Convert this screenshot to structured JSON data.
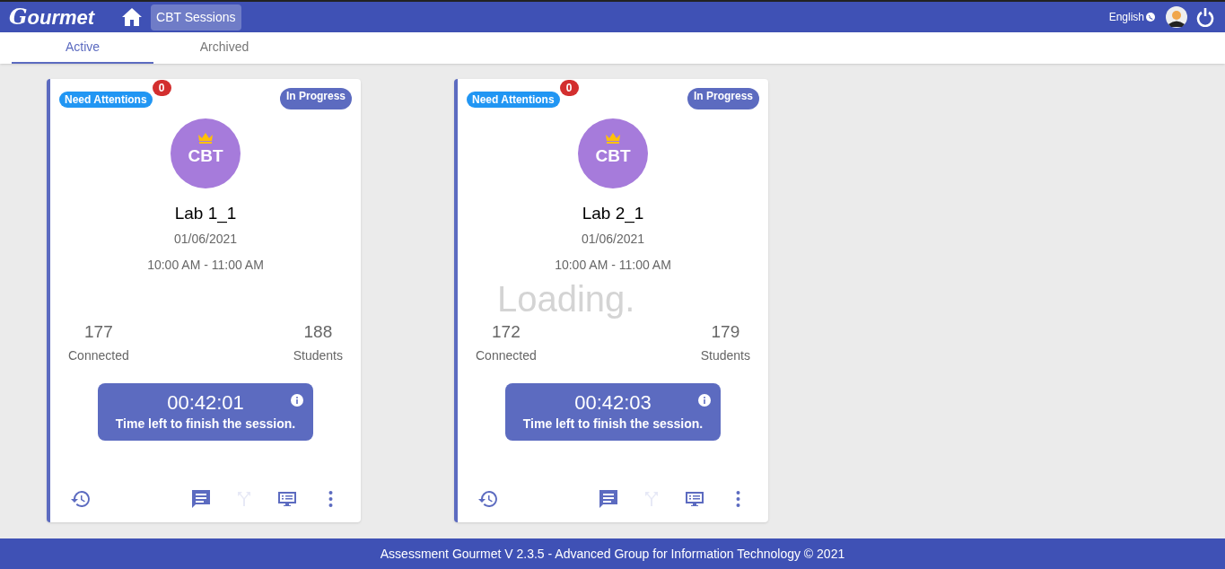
{
  "header": {
    "logo_initial": "G",
    "logo_rest": "ourmet",
    "nav": [
      {
        "label": "CBT Sessions",
        "selected": true
      }
    ],
    "language": "English"
  },
  "tabs": [
    {
      "label": "Active",
      "selected": true
    },
    {
      "label": "Archived",
      "selected": false
    }
  ],
  "sessions": [
    {
      "attention_label": "Need Attentions",
      "attention_count": "0",
      "status": "In Progress",
      "avatar_text": "CBT",
      "name": "Lab 1_1",
      "date": "01/06/2021",
      "time": "10:00 AM - 11:00 AM",
      "connected": "177",
      "connected_label": "Connected",
      "students": "188",
      "students_label": "Students",
      "timer": "00:42:01",
      "timer_label": "Time left to finish the session.",
      "actions": [
        {
          "kind": "history",
          "disabled": false
        },
        {
          "kind": "chat",
          "disabled": false
        },
        {
          "kind": "split",
          "disabled": true
        },
        {
          "kind": "screen",
          "disabled": false
        },
        {
          "kind": "more",
          "disabled": false
        }
      ]
    },
    {
      "attention_label": "Need Attentions",
      "attention_count": "0",
      "status": "In Progress",
      "avatar_text": "CBT",
      "name": "Lab 2_1",
      "date": "01/06/2021",
      "time": "10:00 AM - 11:00 AM",
      "connected": "172",
      "connected_label": "Connected",
      "students": "179",
      "students_label": "Students",
      "timer": "00:42:03",
      "timer_label": "Time left to finish the session.",
      "loading_text": "Loading.",
      "actions": [
        {
          "kind": "history",
          "disabled": false
        },
        {
          "kind": "chat",
          "disabled": false
        },
        {
          "kind": "split",
          "disabled": true
        },
        {
          "kind": "screen",
          "disabled": false
        },
        {
          "kind": "more",
          "disabled": false
        }
      ]
    }
  ],
  "footer": "Assessment Gourmet V 2.3.5 - Advanced Group for Information Technology © 2021"
}
